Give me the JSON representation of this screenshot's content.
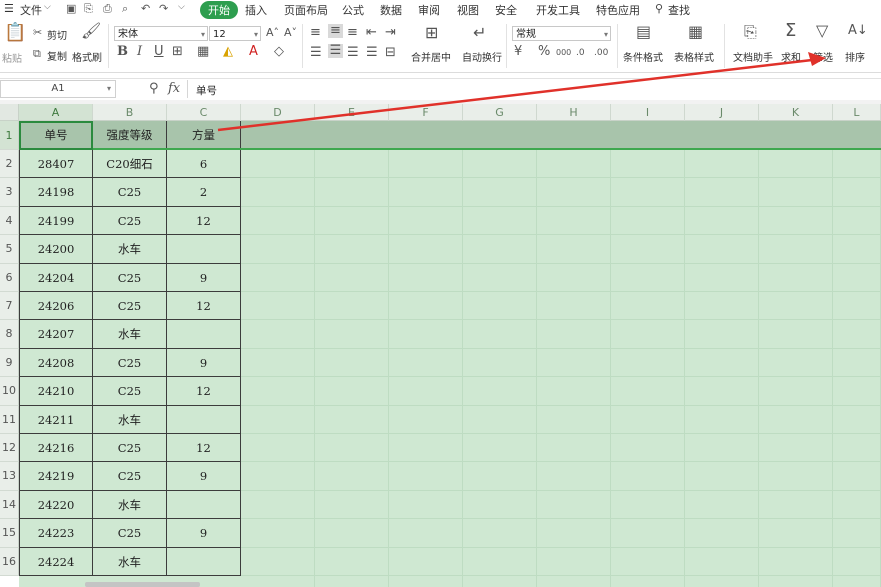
{
  "menubar": {
    "hamburger_icon": "hamburger-icon",
    "file_label": "文件",
    "tabs": [
      "开始",
      "插入",
      "页面布局",
      "公式",
      "数据",
      "审阅",
      "视图",
      "安全",
      "开发工具",
      "特色应用"
    ],
    "active_tab": "开始",
    "search_label": "查找",
    "accent_color": "#2e9e4f"
  },
  "ribbon": {
    "paste": "粘贴",
    "cut": "剪切",
    "copy": "复制",
    "format_painter": "格式刷",
    "font_name": "宋体",
    "font_size": "12",
    "bold": "B",
    "italic": "I",
    "underline": "U",
    "merge_center": "合并居中",
    "auto_wrap": "自动换行",
    "number_format": "常规",
    "percent": "%",
    "thousands": "000",
    "conditional_format": "条件格式",
    "table_style": "表格样式",
    "doc_assistant": "文档助手",
    "sum": "求和",
    "filter": "筛选",
    "sort": "排序"
  },
  "formula_bar": {
    "cell_ref": "A1",
    "fx": "fx",
    "content": "单号"
  },
  "columns": [
    "A",
    "B",
    "C",
    "D",
    "E",
    "F",
    "G",
    "H",
    "I",
    "J",
    "K",
    "L"
  ],
  "rows": [
    "1",
    "2",
    "3",
    "4",
    "5",
    "6",
    "7",
    "8",
    "9",
    "10",
    "11",
    "12",
    "13",
    "14",
    "15",
    "16"
  ],
  "table": {
    "headers": [
      "单号",
      "强度等级",
      "方量"
    ],
    "data": [
      [
        "28407",
        "C20细石",
        "6"
      ],
      [
        "24198",
        "C25",
        "2"
      ],
      [
        "24199",
        "C25",
        "12"
      ],
      [
        "24200",
        "水车",
        ""
      ],
      [
        "24204",
        "C25",
        "9"
      ],
      [
        "24206",
        "C25",
        "12"
      ],
      [
        "24207",
        "水车",
        ""
      ],
      [
        "24208",
        "C25",
        "9"
      ],
      [
        "24210",
        "C25",
        "12"
      ],
      [
        "24211",
        "水车",
        ""
      ],
      [
        "24216",
        "C25",
        "12"
      ],
      [
        "24219",
        "C25",
        "9"
      ],
      [
        "24220",
        "水车",
        ""
      ],
      [
        "24223",
        "C25",
        "9"
      ],
      [
        "24224",
        "水车",
        ""
      ]
    ]
  },
  "annotation_arrow_color": "#e0312a"
}
